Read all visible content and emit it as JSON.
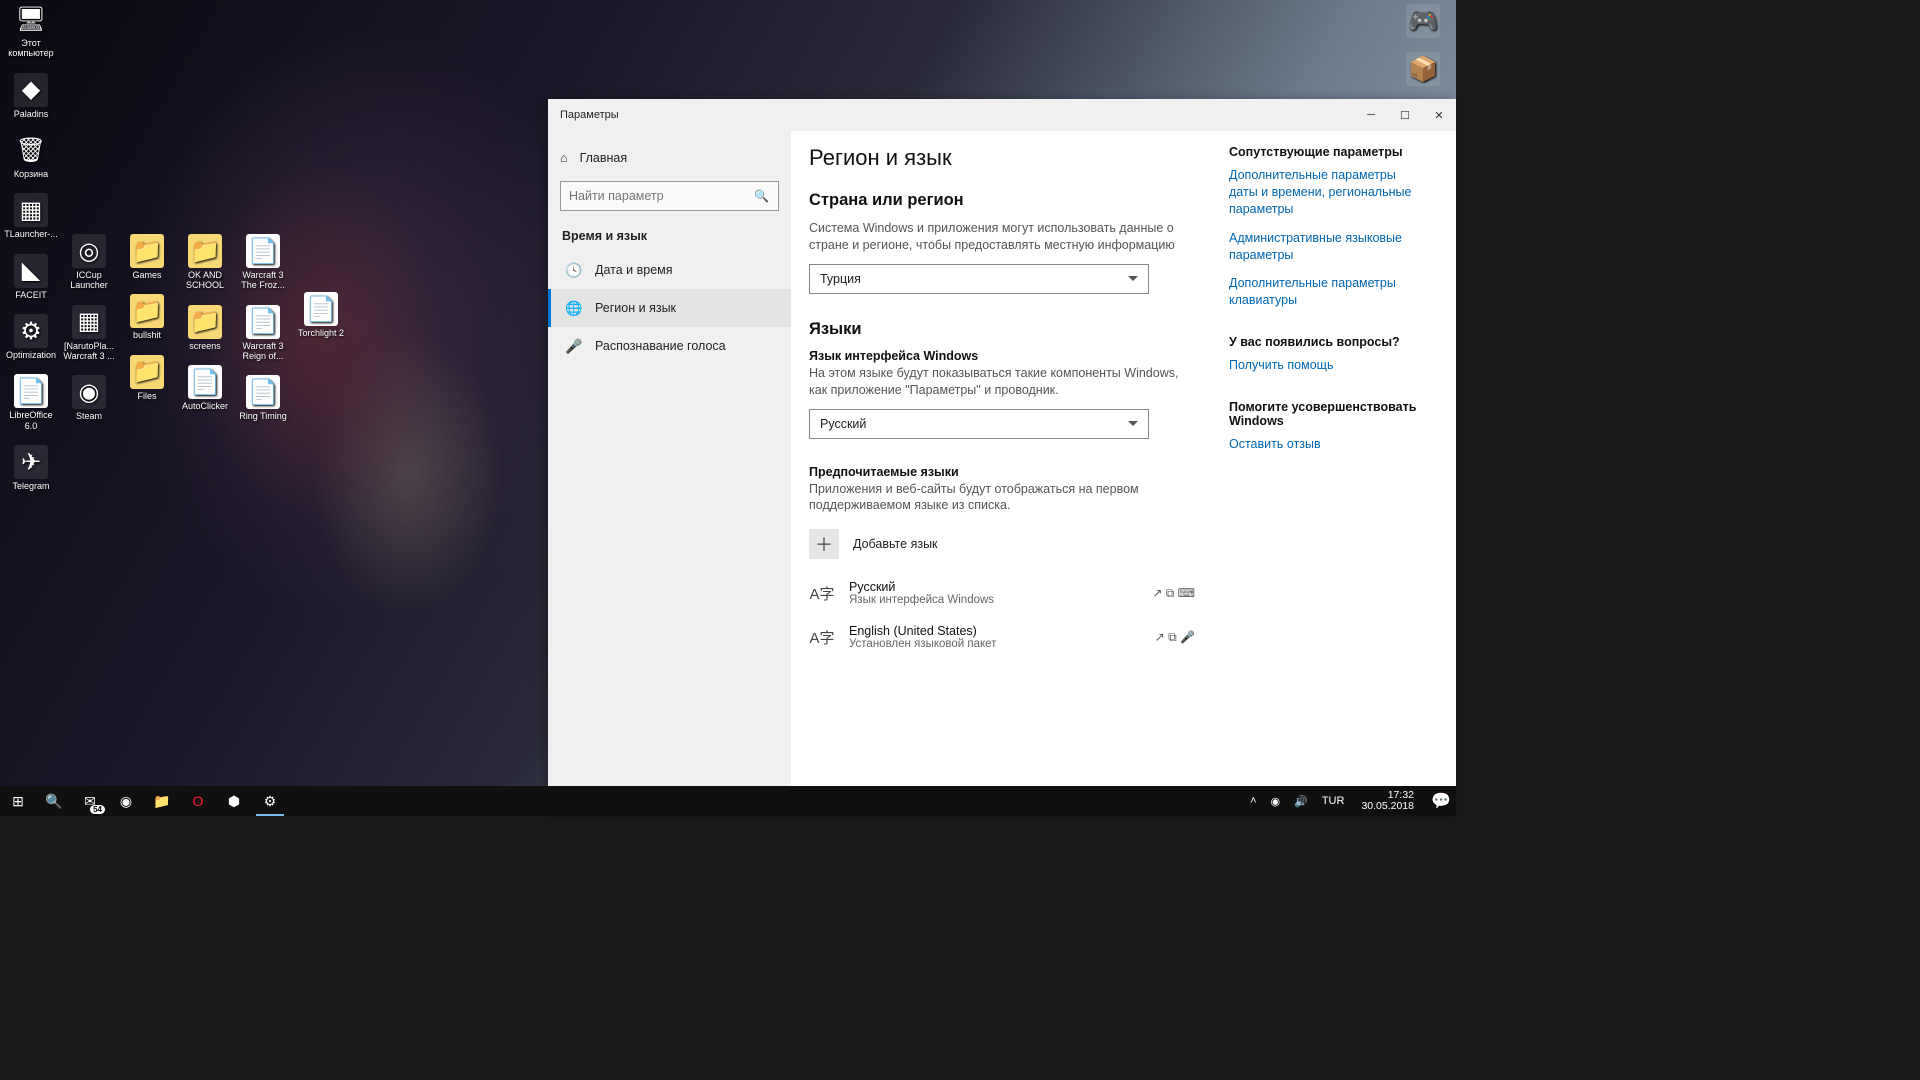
{
  "desktop": {
    "iconsLeft": [
      [
        {
          "label": "Этот компьютер",
          "glyph": "🖥",
          "cls": "pc"
        },
        {
          "label": "Paladins",
          "glyph": "◆",
          "cls": ""
        },
        {
          "label": "Корзина",
          "glyph": "🗑",
          "cls": "trash"
        },
        {
          "label": "TLauncher-...",
          "glyph": "▦",
          "cls": ""
        },
        {
          "label": "FACEIT",
          "glyph": "◣",
          "cls": ""
        },
        {
          "label": "Optimization",
          "glyph": "⚙",
          "cls": ""
        },
        {
          "label": "LibreOffice 6.0",
          "glyph": "📄",
          "cls": "file"
        },
        {
          "label": "Telegram",
          "glyph": "✈",
          "cls": ""
        }
      ],
      [
        {
          "label": "",
          "glyph": "",
          "cls": "",
          "blank": true
        },
        {
          "label": "",
          "glyph": "",
          "cls": "",
          "blank": true
        },
        {
          "label": "",
          "glyph": "",
          "cls": "",
          "blank": true
        },
        {
          "label": "",
          "glyph": "",
          "cls": "",
          "blank": true
        },
        {
          "label": "ICCup Launcher",
          "glyph": "◎",
          "cls": ""
        },
        {
          "label": "[NarutoPla... Warcraft 3 ...",
          "glyph": "▦",
          "cls": ""
        },
        {
          "label": "Steam",
          "glyph": "◉",
          "cls": ""
        }
      ],
      [
        {
          "label": "",
          "glyph": "",
          "cls": "",
          "blank": true
        },
        {
          "label": "",
          "glyph": "",
          "cls": "",
          "blank": true
        },
        {
          "label": "",
          "glyph": "",
          "cls": "",
          "blank": true
        },
        {
          "label": "",
          "glyph": "",
          "cls": "",
          "blank": true
        },
        {
          "label": "Games",
          "glyph": "📁",
          "cls": "folder"
        },
        {
          "label": "bullshit",
          "glyph": "📁",
          "cls": "folder"
        },
        {
          "label": "Files",
          "glyph": "📁",
          "cls": "folder"
        }
      ],
      [
        {
          "label": "",
          "glyph": "",
          "cls": "",
          "blank": true
        },
        {
          "label": "",
          "glyph": "",
          "cls": "",
          "blank": true
        },
        {
          "label": "",
          "glyph": "",
          "cls": "",
          "blank": true
        },
        {
          "label": "",
          "glyph": "",
          "cls": "",
          "blank": true
        },
        {
          "label": "OK AND SCHOOL",
          "glyph": "📁",
          "cls": "folder"
        },
        {
          "label": "screens",
          "glyph": "📁",
          "cls": "folder"
        },
        {
          "label": "AutoClicker",
          "glyph": "📄",
          "cls": "file"
        }
      ],
      [
        {
          "label": "",
          "glyph": "",
          "cls": "",
          "blank": true
        },
        {
          "label": "",
          "glyph": "",
          "cls": "",
          "blank": true
        },
        {
          "label": "",
          "glyph": "",
          "cls": "",
          "blank": true
        },
        {
          "label": "",
          "glyph": "",
          "cls": "",
          "blank": true
        },
        {
          "label": "Warcraft 3 The Froz...",
          "glyph": "📄",
          "cls": "file"
        },
        {
          "label": "Warcraft 3 Reign of...",
          "glyph": "📄",
          "cls": "file"
        },
        {
          "label": "Ring Timing",
          "glyph": "📄",
          "cls": "file"
        }
      ],
      [
        {
          "label": "",
          "glyph": "",
          "cls": "",
          "blank": true
        },
        {
          "label": "",
          "glyph": "",
          "cls": "",
          "blank": true
        },
        {
          "label": "",
          "glyph": "",
          "cls": "",
          "blank": true
        },
        {
          "label": "",
          "glyph": "",
          "cls": "",
          "blank": true
        },
        {
          "label": "",
          "glyph": "",
          "cls": "",
          "blank": true
        },
        {
          "label": "Torchlight 2",
          "glyph": "📄",
          "cls": "file"
        }
      ]
    ],
    "iconsRight": [
      {
        "label": "",
        "glyph": "🎮",
        "cls": ""
      },
      {
        "label": "",
        "glyph": "📦",
        "cls": ""
      }
    ]
  },
  "window": {
    "title": "Параметры",
    "sidebar": {
      "home": "Главная",
      "searchPlaceholder": "Найти параметр",
      "section": "Время и язык",
      "items": [
        {
          "icon": "🕓",
          "label": "Дата и время",
          "active": false
        },
        {
          "icon": "🌐",
          "label": "Регион и язык",
          "active": true
        },
        {
          "icon": "🎤",
          "label": "Распознавание голоса",
          "active": false
        }
      ]
    },
    "content": {
      "heading": "Регион и язык",
      "sectionCountry": "Страна или регион",
      "countryDesc": "Система Windows и приложения могут использовать данные о стране и регионе, чтобы предоставлять местную информацию",
      "countryValue": "Турция",
      "sectionLangs": "Языки",
      "displayLangLabel": "Язык интерфейса Windows",
      "displayLangDesc": "На этом языке будут показываться такие компоненты Windows, как приложение \"Параметры\" и проводник.",
      "displayLangValue": "Русский",
      "prefLangLabel": "Предпочитаемые языки",
      "prefLangDesc": "Приложения и веб-сайты будут отображаться на первом поддерживаемом языке из списка.",
      "addLang": "Добавьте язык",
      "langs": [
        {
          "name": "Русский",
          "sub": "Язык интерфейса Windows",
          "icons": "↗ ⧉ ⌨"
        },
        {
          "name": "English (United States)",
          "sub": "Установлен языковой пакет",
          "icons": "↗ ⧉ 🎤"
        }
      ]
    },
    "rail": {
      "relatedTitle": "Сопутствующие параметры",
      "links": [
        "Дополнительные параметры даты и времени, региональные параметры",
        "Административные языковые параметры",
        "Дополнительные параметры клавиатуры"
      ],
      "qTitle": "У вас появились вопросы?",
      "qLink": "Получить помощь",
      "fbTitle": "Помогите усовершенствовать Windows",
      "fbLink": "Оставить отзыв"
    }
  },
  "taskbar": {
    "mailBadge": "54",
    "lang": "TUR",
    "time": "17:32",
    "date": "30.05.2018"
  }
}
